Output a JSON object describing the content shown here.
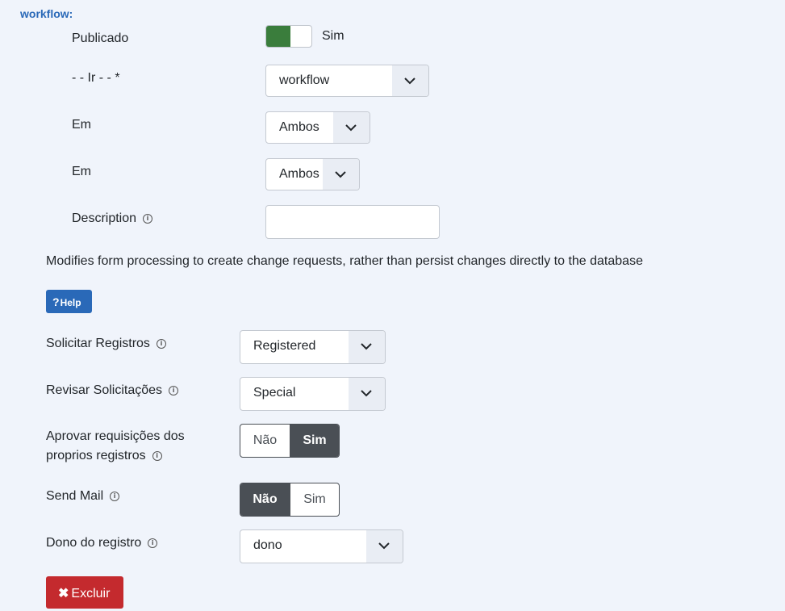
{
  "section": {
    "title": "workflow:"
  },
  "publicado": {
    "label": "Publicado",
    "toggle_label": "Sim",
    "state": "on",
    "accent": "#3a7d3c"
  },
  "ir": {
    "label": "- - Ir - -  *",
    "value": "workflow"
  },
  "em1": {
    "label": "Em",
    "value": "Ambos"
  },
  "em2": {
    "label": "Em",
    "value": "Ambos"
  },
  "description": {
    "label": "Description",
    "value": ""
  },
  "info_text": "Modifies form processing to create change requests, rather than persist changes directly to the database",
  "help": {
    "label": "Help",
    "icon": "question-icon",
    "color": "#2a69b8"
  },
  "solicitar": {
    "label": "Solicitar Registros",
    "value": "Registered"
  },
  "revisar": {
    "label": "Revisar Solicitações",
    "value": "Special"
  },
  "aprovar": {
    "label": "Aprovar requisições dos proprios registros",
    "options": [
      "Não",
      "Sim"
    ],
    "selected": "Sim"
  },
  "sendmail": {
    "label": "Send Mail",
    "options": [
      "Não",
      "Sim"
    ],
    "selected": "Não"
  },
  "dono": {
    "label": "Dono do registro",
    "value": "dono"
  },
  "excluir": {
    "label": "Excluir",
    "icon": "x-icon",
    "color": "#c42a2e"
  }
}
